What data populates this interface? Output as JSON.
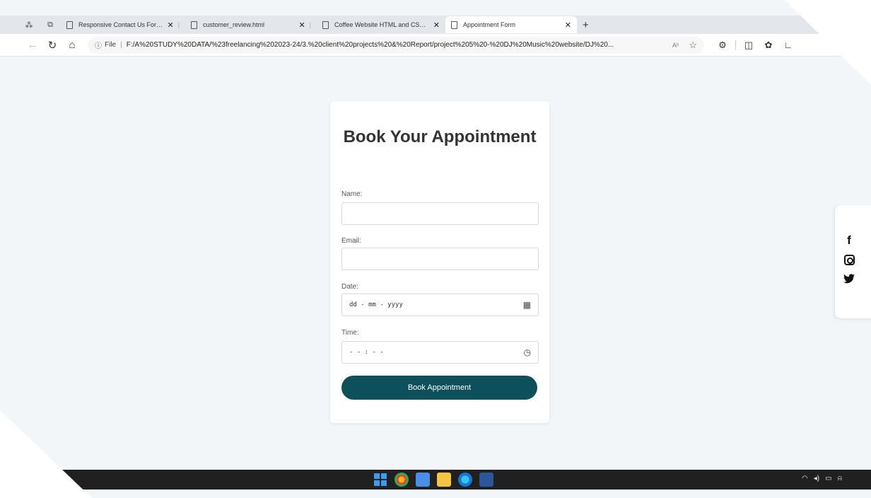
{
  "browser": {
    "tabs": [
      {
        "title": "Responsive Contact Us Form | Co",
        "active": false
      },
      {
        "title": "customer_review.html",
        "active": false
      },
      {
        "title": "Coffee Website HTML and CSS | (",
        "active": false
      },
      {
        "title": "Appointment Form",
        "active": true
      }
    ],
    "new_tab": "+",
    "close_symbol": "✕",
    "address": {
      "file_label": "File",
      "separator": "|",
      "url": "F:/A%20STUDY%20DATA/%23freelancing%202023-24/3.%20client%20projects%20&%20Report/project%205%20-%20DJ%20Music%20website/DJ%20...",
      "read_aloud": "Aʰ"
    }
  },
  "form": {
    "title": "Book Your Appointment",
    "name_label": "Name:",
    "email_label": "Email:",
    "date_label": "Date:",
    "date_placeholder": "dd - mm - yyyy",
    "time_label": "Time:",
    "time_placeholder": "- - : - -",
    "submit_label": "Book Appointment"
  },
  "social": {
    "icons": [
      "facebook-icon",
      "instagram-icon",
      "twitter-icon"
    ]
  },
  "colors": {
    "page_bg": "#f3f6f9",
    "button_bg": "#0d4f5a",
    "taskbar_bg": "#202020"
  }
}
